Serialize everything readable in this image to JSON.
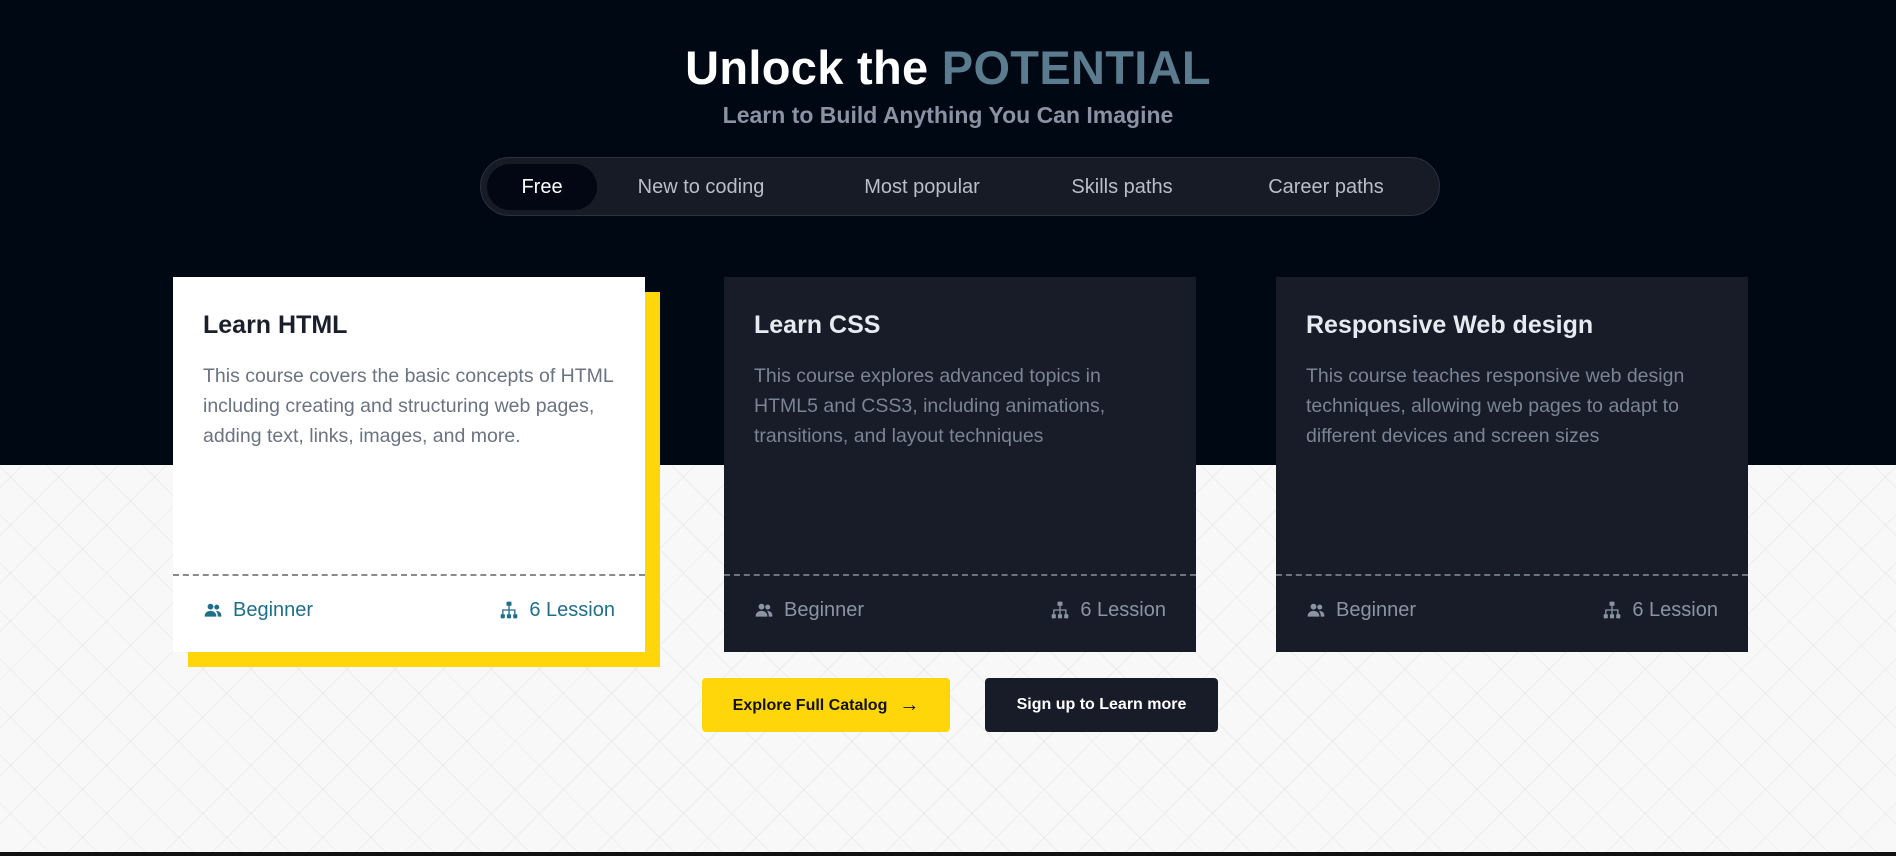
{
  "hero": {
    "title_start": "Unlock the ",
    "title_accent": "POTENTIAL",
    "subtitle": "Learn to Build Anything You Can Imagine"
  },
  "tabs": [
    {
      "label": "Free",
      "active": true
    },
    {
      "label": "New to coding",
      "active": false
    },
    {
      "label": "Most popular",
      "active": false
    },
    {
      "label": "Skills paths",
      "active": false
    },
    {
      "label": "Career paths",
      "active": false
    }
  ],
  "cards": [
    {
      "title": "Learn HTML",
      "description": "This course covers the basic concepts of HTML including creating and structuring web pages, adding text, links, images, and more.",
      "level": "Beginner",
      "lessons": "6 Lession",
      "featured": true
    },
    {
      "title": "Learn CSS",
      "description": "This course explores advanced topics in HTML5 and CSS3, including animations, transitions, and layout techniques",
      "level": "Beginner",
      "lessons": "6 Lession",
      "featured": false
    },
    {
      "title": "Responsive Web design",
      "description": "This course teaches responsive web design techniques, allowing web pages to adapt to different devices and screen sizes",
      "level": "Beginner",
      "lessons": "6 Lession",
      "featured": false
    }
  ],
  "actions": {
    "explore_label": "Explore Full Catalog",
    "signup_label": "Sign up to Learn more"
  },
  "icons": {
    "level": "users-icon",
    "lessons": "sitemap-icon",
    "explore": "arrow-right-icon"
  },
  "colors": {
    "hero_background": "#000814",
    "accent_title": "#5b7b8e",
    "highlight_yellow": "#ffd60a",
    "card_dark": "#171c28",
    "featured_meta": "#1f6f8b"
  }
}
